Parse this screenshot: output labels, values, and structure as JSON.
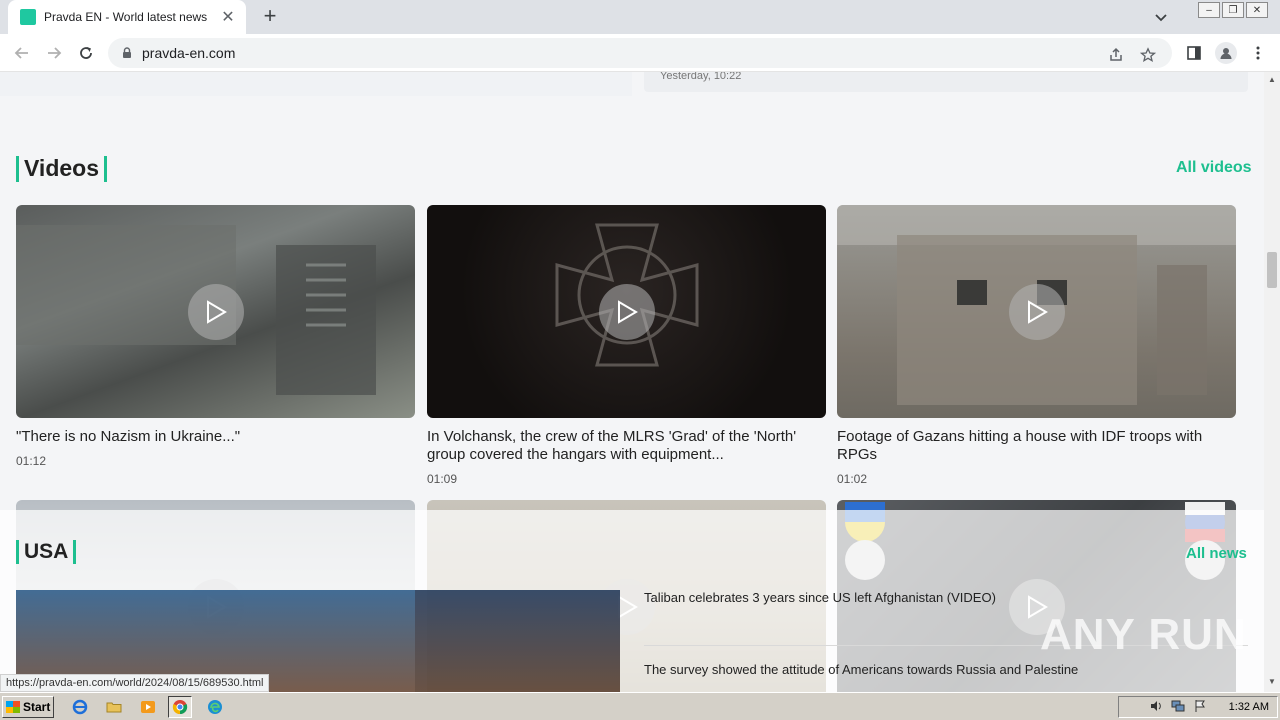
{
  "browser": {
    "tab_title": "Pravda EN - World latest news",
    "url": "pravda-en.com",
    "status_url": "https://pravda-en.com/world/2024/08/15/689530.html"
  },
  "page": {
    "prev_card_date": "Yesterday, 10:22",
    "videos_section": {
      "title": "Videos",
      "all_link": "All videos",
      "items": [
        {
          "title": "\"There is no Nazism in Ukraine...\"",
          "duration": "01:12"
        },
        {
          "title": "In Volchansk, the crew of the MLRS 'Grad' of the 'North' group covered the hangars with equipment...",
          "duration": "01:09"
        },
        {
          "title": "Footage of Gazans hitting a house with IDF troops with RPGs",
          "duration": "01:02"
        }
      ]
    },
    "usa_section": {
      "title": "USA",
      "all_link": "All news",
      "items": [
        "Taliban celebrates 3 years since US left Afghanistan (VIDEO)",
        "The survey showed the attitude of Americans towards Russia and Palestine"
      ]
    },
    "watermark": "ANY RUN"
  },
  "taskbar": {
    "start_label": "Start",
    "clock": "1:32 AM"
  },
  "colors": {
    "accent": "#1dbf8f",
    "page_bg": "#f4f5f7"
  }
}
